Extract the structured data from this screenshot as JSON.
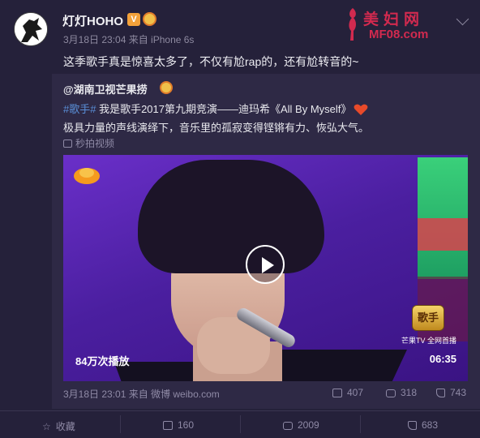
{
  "post": {
    "username": "灯灯HOHO",
    "verified_badge": "V",
    "meta": "3月18日 23:04 来自 iPhone 6s",
    "text": "这季歌手真是惊喜太多了，不仅有尬rap的，还有尬转音的~"
  },
  "watermark": {
    "title": "美妇网",
    "url": "MF08.com"
  },
  "repost": {
    "author": "@湖南卫视芒果捞",
    "tag": "#歌手#",
    "title_rest": " 我是歌手2017第九期竞演——迪玛希《All By Myself》",
    "description": "极具力量的声线演绎下，音乐里的孤寂变得铿锵有力、恢弘大气。",
    "link_label": "秒拍视频",
    "video": {
      "play_count": "84万次播放",
      "duration": "06:35",
      "show_logo": "歌手",
      "caption": "芒果TV 全网首播"
    },
    "footer": "3月18日 23:01 来自 微博 weibo.com",
    "stats": {
      "reposts": "407",
      "comments": "318",
      "likes": "743"
    }
  },
  "actions": {
    "favorite": "收藏",
    "repost": "160",
    "comment": "2009",
    "like": "683"
  },
  "colors": {
    "background": "#25213a",
    "repost_bg": "#2e2945",
    "accent_tag": "#5a8fd8",
    "watermark": "#d22a4f"
  }
}
